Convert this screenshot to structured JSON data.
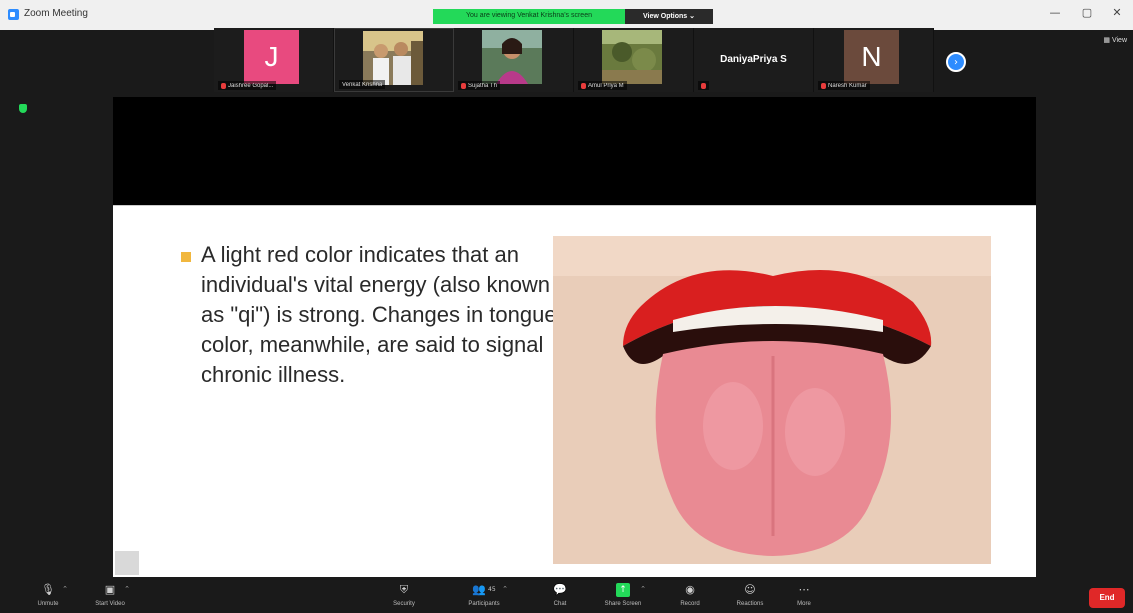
{
  "window": {
    "title": "Zoom Meeting",
    "banner_text": "You are viewing Venkat Krishna's screen",
    "view_options_label": "View Options ⌄",
    "minimize_glyph": "—",
    "maximize_glyph": "▢",
    "close_glyph": "✕"
  },
  "view_toggle": "▦ View",
  "participants": [
    {
      "name": "Jaishree Gopal...",
      "initial": "J",
      "color": "#e84a7f",
      "muted": true,
      "type": "initial"
    },
    {
      "name": "Venkat Krishna",
      "muted": false,
      "type": "photo",
      "photo": "group"
    },
    {
      "name": "Sujatha Th",
      "muted": true,
      "type": "photo",
      "photo": "woman"
    },
    {
      "name": "Amul Priya M",
      "muted": true,
      "type": "photo",
      "photo": "outdoor"
    },
    {
      "name": "DaniyaPriya S",
      "muted": true,
      "type": "name"
    },
    {
      "name": "Naresh Kumar",
      "initial": "N",
      "color": "#6b4a3c",
      "muted": true,
      "type": "initial"
    }
  ],
  "next_page_glyph": "›",
  "slide": {
    "text": "A light red color indicates that an individual's vital energy (also known as \"qi\") is strong. Changes in tongue color, meanwhile, are said to signal chronic illness.",
    "bullet_color": "#f1b73e"
  },
  "toolbar": {
    "unmute": "Unmute",
    "start_video": "Start Video",
    "security": "Security",
    "participants": "Participants",
    "participants_count": "45",
    "chat": "Chat",
    "share_screen": "Share Screen",
    "record": "Record",
    "reactions": "Reactions",
    "more": "More",
    "end": "End"
  },
  "colors": {
    "zoom_blue": "#2d8cff",
    "share_green": "#23d959",
    "end_red": "#e02828"
  }
}
